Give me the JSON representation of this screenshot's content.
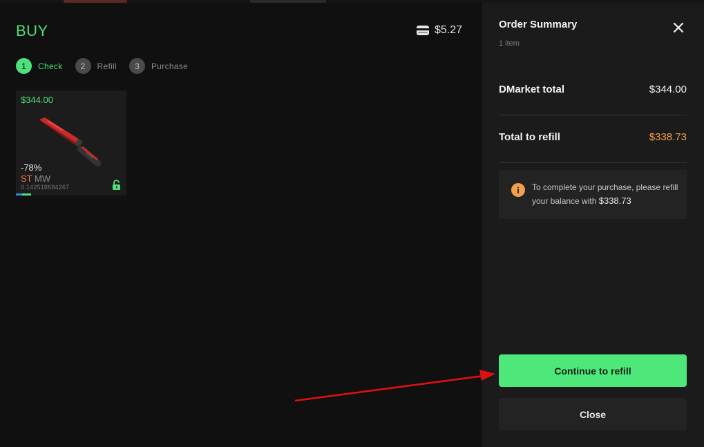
{
  "buy": {
    "title": "BUY",
    "balance": "$5.27"
  },
  "steps": [
    {
      "number": "1",
      "label": "Check",
      "active": true
    },
    {
      "number": "2",
      "label": "Refill",
      "active": false
    },
    {
      "number": "3",
      "label": "Purchase",
      "active": false
    }
  ],
  "item": {
    "price": "$344.00",
    "discount": "-78%",
    "stattrak": "ST",
    "wear": "MW",
    "float": "0.142518684267"
  },
  "order_summary": {
    "title": "Order Summary",
    "item_count": "1 item",
    "dmarket_total_label": "DMarket total",
    "dmarket_total_value": "$344.00",
    "refill_label": "Total to refill",
    "refill_value": "$338.73",
    "info_text": "To complete your purchase, please refill your balance with",
    "info_amount": "$338.73",
    "continue_button": "Continue to refill",
    "close_button": "Close"
  },
  "colors": {
    "accent_green": "#4ee07a",
    "refill_orange": "#f5a04a",
    "annotation_red": "#e01010"
  }
}
